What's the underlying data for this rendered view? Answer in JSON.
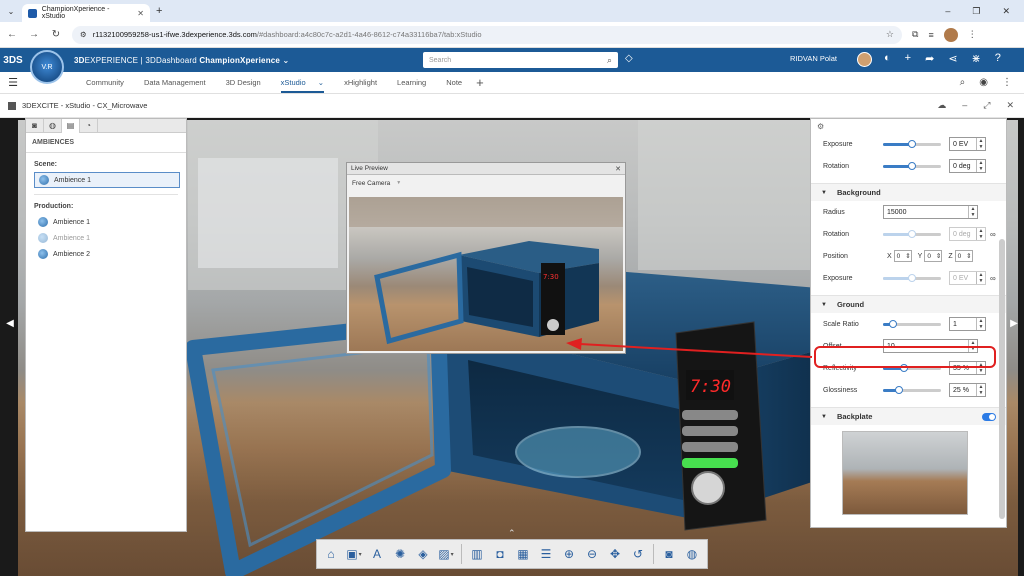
{
  "browser": {
    "tab_title": "ChampionXperience - xStudio",
    "url_host": "r1132100959258-us1-ifwe.3dexperience.3ds.com",
    "url_path": "/#dashboard:a4c80c7c-a2d1-4a46-8612-c74a33116ba7/tab:xStudio"
  },
  "topbar": {
    "brand_prefix": "3D",
    "brand_main": "EXPERIENCE | 3DDashboard",
    "brand_dash": " ChampionXperience",
    "search_placeholder": "Search",
    "user_name": "RIDVAN Polat",
    "compass_label": "V.R"
  },
  "app_tabs": [
    {
      "label": "Community",
      "active": false
    },
    {
      "label": "Data Management",
      "active": false
    },
    {
      "label": "3D Design",
      "active": false
    },
    {
      "label": "xStudio",
      "active": true
    },
    {
      "label": "xHighlight",
      "active": false
    },
    {
      "label": "Learning",
      "active": false
    },
    {
      "label": "Note",
      "active": false
    }
  ],
  "app_title": "3DEXCITE - xStudio - CX_Microwave",
  "left_panel": {
    "header": "AMBIENCES",
    "scene_label": "Scene:",
    "scene_items": [
      {
        "label": "Ambience 1",
        "selected": true
      }
    ],
    "production_label": "Production:",
    "production_items": [
      {
        "label": "Ambience 1",
        "dim": false
      },
      {
        "label": "Ambience 1",
        "dim": true
      },
      {
        "label": "Ambience 2",
        "dim": false
      }
    ]
  },
  "right_panel": {
    "lighting": {
      "exposure_label": "Exposure",
      "exposure_value": "0 EV",
      "exposure_level": 0.5,
      "rotation_label": "Rotation",
      "rotation_value": "0 deg",
      "rotation_level": 0.5
    },
    "background": {
      "title": "Background",
      "radius_label": "Radius",
      "radius_value": "15000",
      "rotation_label": "Rotation",
      "rotation_value": "0 deg",
      "rotation_level": 0.5,
      "position_label": "Position",
      "pos_x_label": "X",
      "pos_x": "0",
      "pos_y_label": "Y",
      "pos_y": "0",
      "pos_z_label": "Z",
      "pos_z": "0",
      "exposure_label": "Exposure",
      "exposure_value": "0 EV",
      "exposure_level": 0.5
    },
    "ground": {
      "title": "Ground",
      "scale_label": "Scale Ratio",
      "scale_value": "1",
      "scale_level": 0.15,
      "offset_label": "Offset",
      "offset_value": "10",
      "reflectivity_label": "Reflectivity",
      "reflectivity_value": "35 %",
      "reflectivity_level": 0.35,
      "glossiness_label": "Glossiness",
      "glossiness_value": "25 %",
      "glossiness_level": 0.25
    },
    "backplate": {
      "title": "Backplate",
      "enabled": true
    }
  },
  "live_preview": {
    "title": "Live Preview",
    "camera": "Free Camera"
  },
  "microwave_display": "7:30",
  "preview_display": "7:30",
  "colors": {
    "brand_blue": "#1c5a96",
    "accent_blue": "#3a7cc5",
    "highlight_red": "#e02020",
    "microwave_blue": "#1f4f78"
  }
}
